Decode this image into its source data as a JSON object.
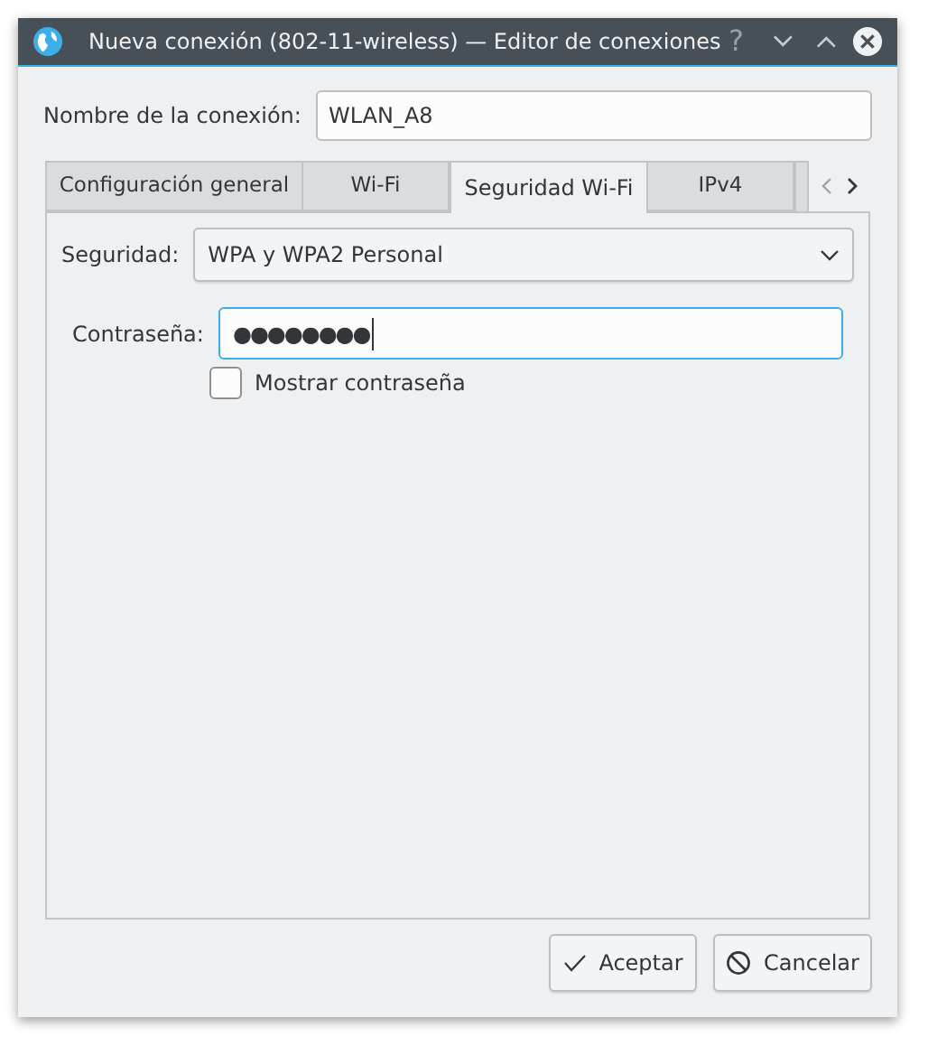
{
  "window": {
    "title": "Nueva conexión (802-11-wireless) — Editor de conexiones",
    "help": "?"
  },
  "connection_name": {
    "label": "Nombre de la conexión:",
    "value": "WLAN_A8"
  },
  "tabs": [
    {
      "label": "Configuración general",
      "selected": false
    },
    {
      "label": "Wi-Fi",
      "selected": false
    },
    {
      "label": "Seguridad Wi-Fi",
      "selected": true
    },
    {
      "label": "IPv4",
      "selected": false
    }
  ],
  "security": {
    "label": "Seguridad:",
    "value": "WPA y WPA2 Personal"
  },
  "password": {
    "label": "Contraseña:",
    "value": "●●●●●●●●",
    "focused": true
  },
  "show_password": {
    "label": "Mostrar contraseña",
    "checked": false
  },
  "buttons": [
    {
      "label": "Aceptar",
      "kind": "ok"
    },
    {
      "label": "Cancelar",
      "kind": "cancel"
    }
  ]
}
